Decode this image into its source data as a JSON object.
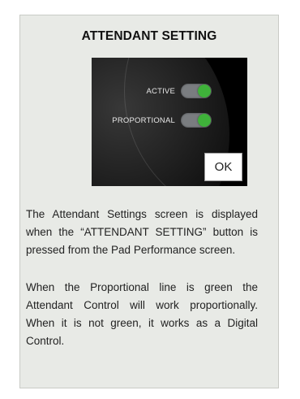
{
  "title": "ATTENDANT SETTING",
  "screen": {
    "active_label": "ACTIVE",
    "proportional_label": "PROPORTIONAL",
    "active_on": true,
    "proportional_on": true,
    "ok_label": "OK",
    "toggle_on_color": "#3fb23a"
  },
  "paragraphs": [
    "The Attendant Settings screen is displayed when the “ATTENDANT SETTING” button is pressed from the Pad Performance screen.",
    "When the Proportional line is green the Attendant Control will work proportionally. When it is not green, it works as a Digital Control."
  ]
}
